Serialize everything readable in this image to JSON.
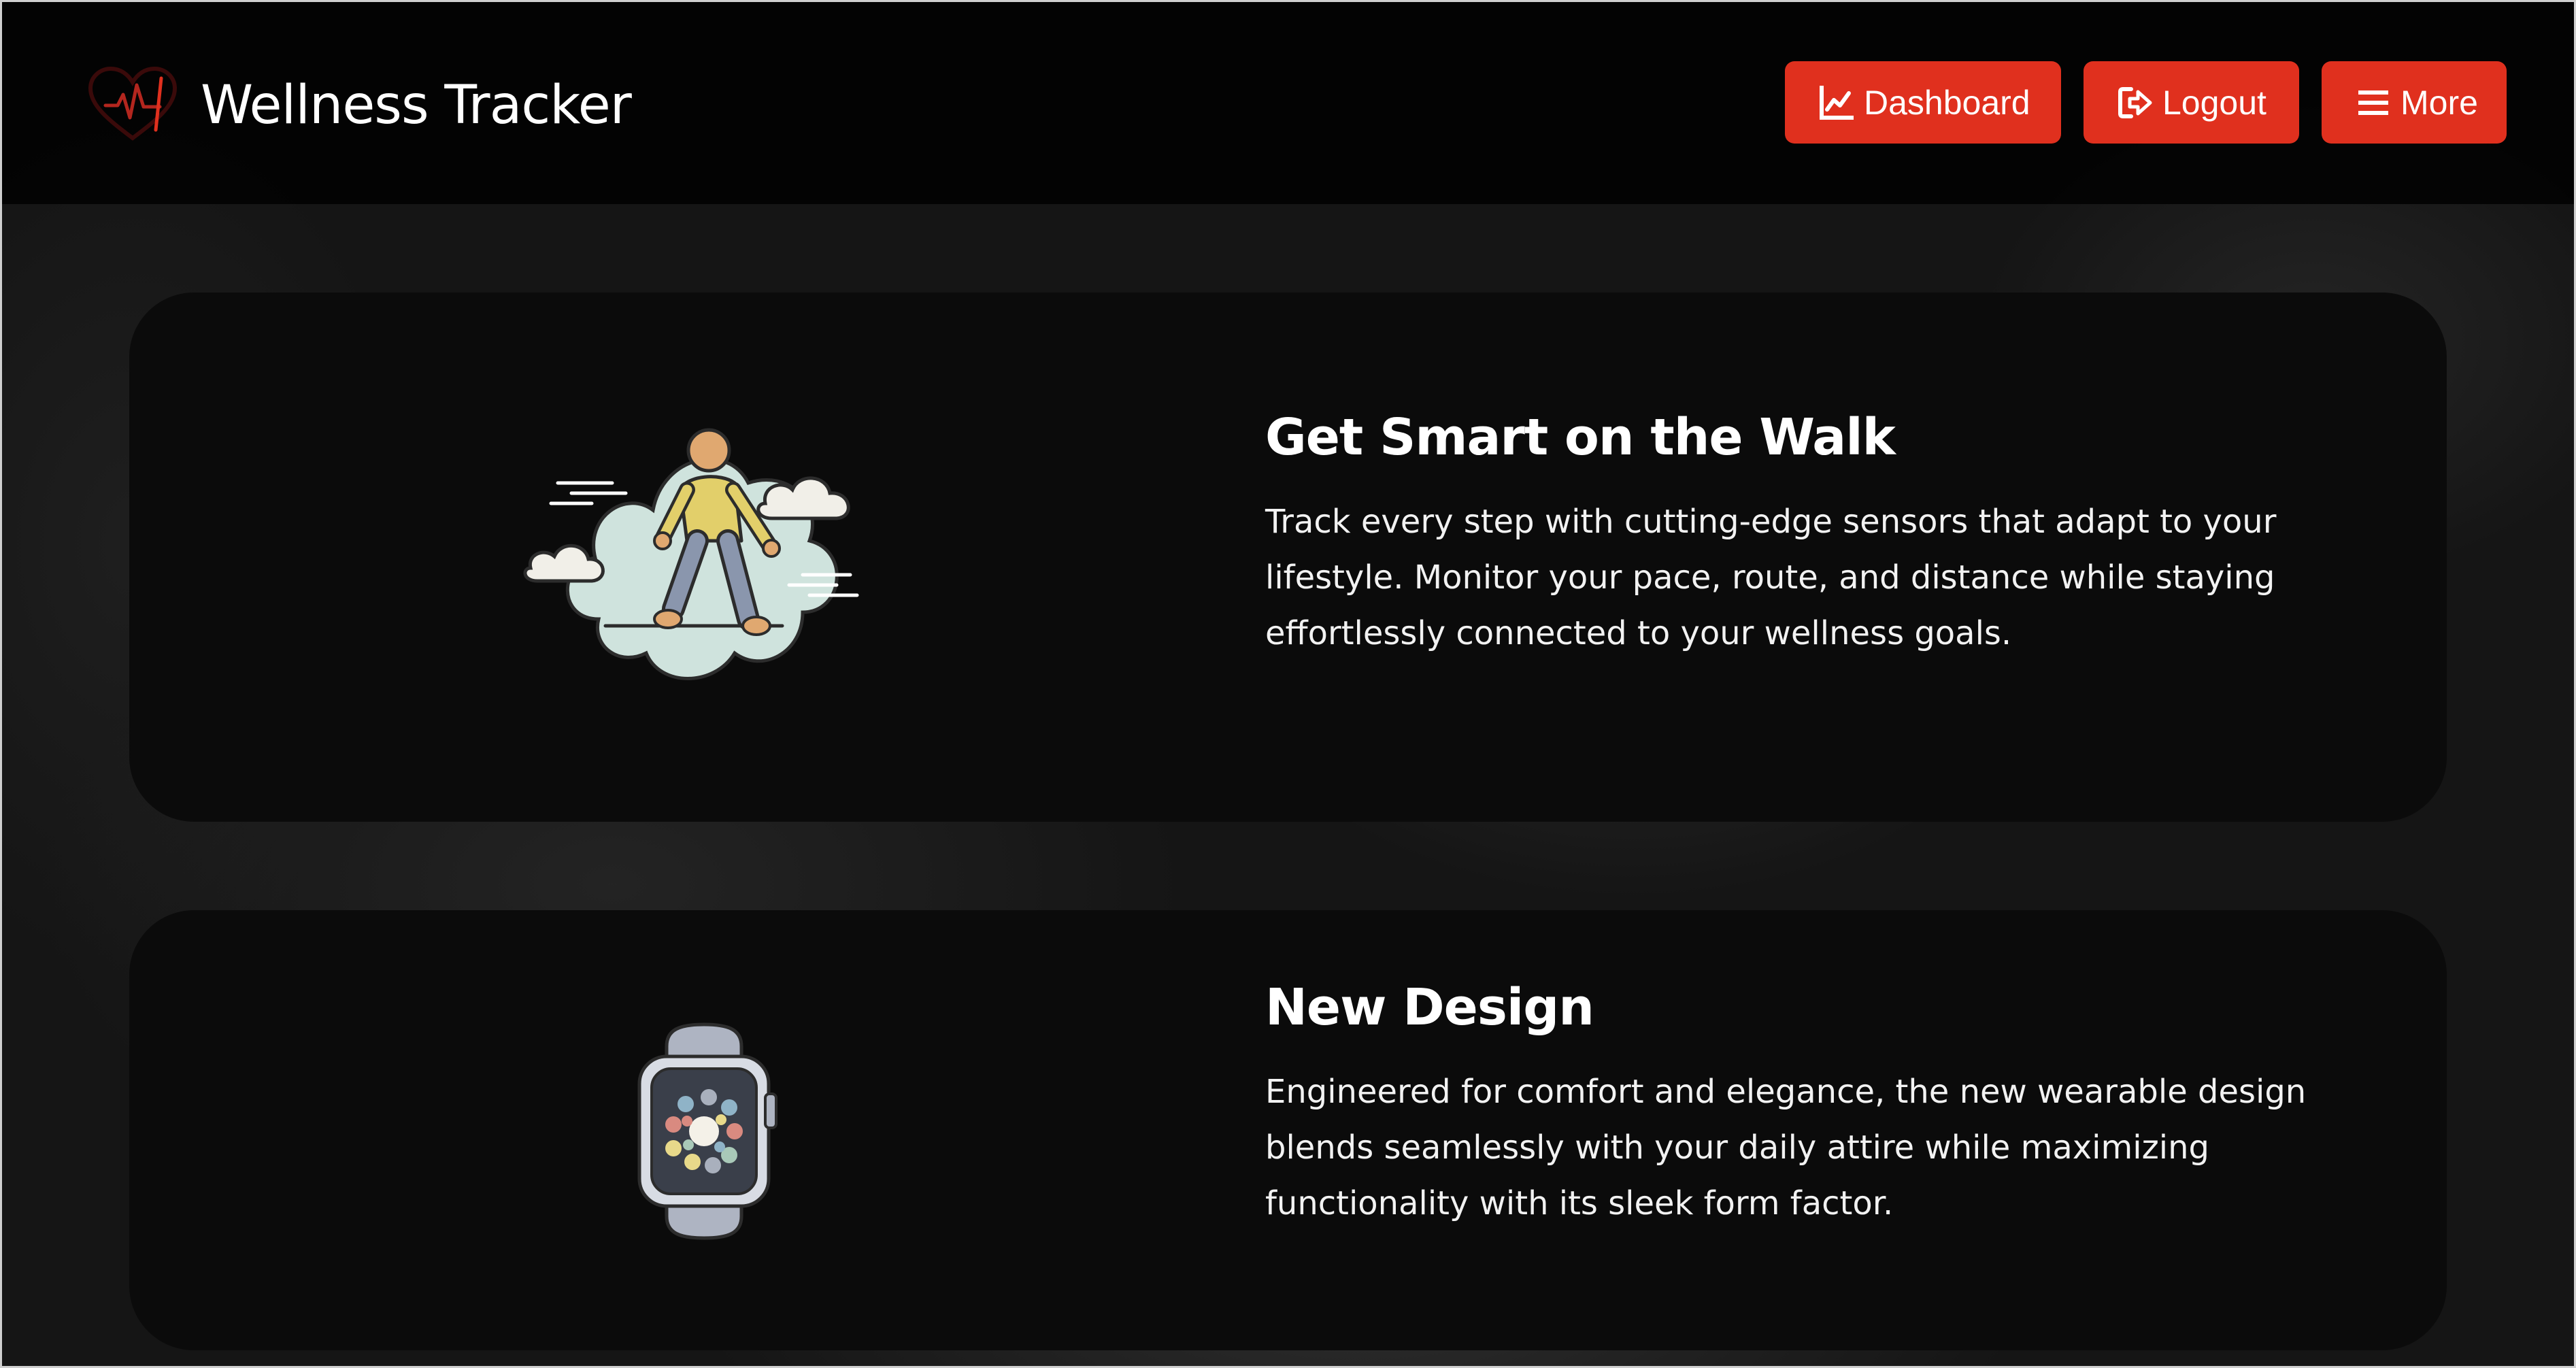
{
  "header": {
    "title": "Wellness Tracker",
    "logo_icon": "heart-pulse-icon"
  },
  "nav": {
    "dashboard_label": "Dashboard",
    "dashboard_icon": "line-chart-icon",
    "logout_label": "Logout",
    "logout_icon": "sign-out-icon",
    "more_label": "More",
    "more_icon": "hamburger-menu-icon",
    "button_color": "#e0301e"
  },
  "cards": [
    {
      "title": "Get Smart on the Walk",
      "body": "Track every step with cutting-edge sensors that adapt to your lifestyle. Monitor your pace, route, and distance while staying effortlessly connected to your wellness goals.",
      "illustration": "walking-person-clouds-icon"
    },
    {
      "title": "New Design",
      "body": "Engineered for comfort and elegance, the new wearable design blends seamlessly with your daily attire while maximizing functionality with its sleek form factor.",
      "illustration": "smartwatch-icon"
    }
  ]
}
